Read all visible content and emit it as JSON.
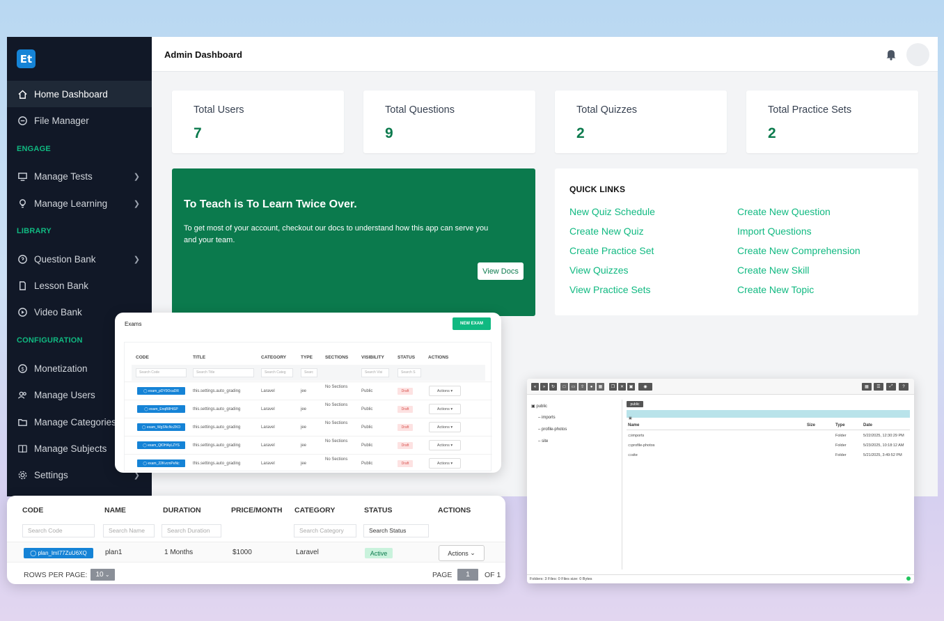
{
  "header": {
    "title": "Admin Dashboard"
  },
  "logo": {
    "text": "Et"
  },
  "sidebar": {
    "items": [
      {
        "label": "Home Dashboard",
        "icon": "home-icon"
      },
      {
        "label": "File Manager",
        "icon": "file-manager-icon"
      },
      {
        "label": "Manage Tests",
        "icon": "monitor-icon"
      },
      {
        "label": "Manage Learning",
        "icon": "bulb-icon"
      },
      {
        "label": "Question Bank",
        "icon": "question-icon"
      },
      {
        "label": "Lesson Bank",
        "icon": "document-icon"
      },
      {
        "label": "Video Bank",
        "icon": "play-icon"
      },
      {
        "label": "Monetization",
        "icon": "dollar-icon"
      },
      {
        "label": "Manage Users",
        "icon": "users-icon"
      },
      {
        "label": "Manage Categories",
        "icon": "folder-icon"
      },
      {
        "label": "Manage Subjects",
        "icon": "book-icon"
      },
      {
        "label": "Settings",
        "icon": "gear-icon"
      }
    ],
    "sections": [
      "ENGAGE",
      "LIBRARY",
      "CONFIGURATION"
    ]
  },
  "stats": [
    {
      "label": "Total Users",
      "value": "7"
    },
    {
      "label": "Total Questions",
      "value": "9"
    },
    {
      "label": "Total Quizzes",
      "value": "2"
    },
    {
      "label": "Total Practice Sets",
      "value": "2"
    }
  ],
  "hero": {
    "title": "To Teach is To Learn Twice Over.",
    "text": "To get most of your account, checkout our docs to understand how this app can serve you and your team.",
    "button": "View Docs"
  },
  "quick_links": {
    "title": "QUICK LINKS",
    "left": [
      "New Quiz Schedule",
      "Create New Quiz",
      "Create Practice Set",
      "View Quizzes",
      "View Practice Sets"
    ],
    "right": [
      "Create New Question",
      "Import Questions",
      "Create New Comprehension",
      "Create New Skill",
      "Create New Topic"
    ]
  },
  "exams": {
    "title": "Exams",
    "new_button": "NEW EXAM",
    "columns": [
      "CODE",
      "TITLE",
      "CATEGORY",
      "TYPE",
      "SECTIONS",
      "VISIBILITY",
      "STATUS",
      "ACTIONS"
    ],
    "search": [
      "Search Code",
      "Search Title",
      "Search Categ",
      "Searc",
      "Search Visi",
      "Search S"
    ],
    "rows": [
      {
        "code": "exam_pDY0OcaDR",
        "title": "this.settings.auto_grading",
        "category": "Laravel",
        "type": "jee",
        "sections": "No Sections",
        "visibility": "Public",
        "status": "Draft",
        "actions": "Actions"
      },
      {
        "code": "exam_EnqB8HiSP",
        "title": "this.settings.auto_grading",
        "category": "Laravel",
        "type": "jee",
        "sections": "No Sections",
        "visibility": "Public",
        "status": "Draft",
        "actions": "Actions"
      },
      {
        "code": "exam_WgSNcNcZKO",
        "title": "this.settings.auto_grading",
        "category": "Laravel",
        "type": "jee",
        "sections": "No Sections",
        "visibility": "Public",
        "status": "Draft",
        "actions": "Actions"
      },
      {
        "code": "exam_QlOHAyLZYS",
        "title": "this.settings.auto_grading",
        "category": "Laravel",
        "type": "jee",
        "sections": "No Sections",
        "visibility": "Public",
        "status": "Draft",
        "actions": "Actions"
      },
      {
        "code": "exam_22KvcmPeNc",
        "title": "this.settings.auto_grading",
        "category": "Laravel",
        "type": "jee",
        "sections": "No Sections",
        "visibility": "Public",
        "status": "Draft",
        "actions": "Actions"
      }
    ]
  },
  "file_manager": {
    "tree": [
      "public",
      "imports",
      "profile-photos",
      "site"
    ],
    "crumb": "public",
    "columns": [
      "Name",
      "Size",
      "Type",
      "Date"
    ],
    "rows": [
      {
        "name": "imports",
        "type": "Folder",
        "date": "5/22/2025, 12:30:29 PM"
      },
      {
        "name": "profile-photos",
        "type": "Folder",
        "date": "5/23/2025, 10:18:12 AM"
      },
      {
        "name": "site",
        "type": "Folder",
        "date": "5/21/2025, 3:49:52 PM"
      }
    ],
    "footer": "Folders: 3 Files: 0 Files size: 0 Bytes"
  },
  "plans": {
    "columns": [
      "CODE",
      "NAME",
      "DURATION",
      "PRICE/MONTH",
      "CATEGORY",
      "STATUS",
      "ACTIONS"
    ],
    "search": [
      "Search Code",
      "Search Name",
      "Search Duration",
      "Search Category",
      "Search Status"
    ],
    "row": {
      "code": "plan_lmI77ZuU6XQ",
      "name": "plan1",
      "duration": "1 Months",
      "price": "$1000",
      "category": "Laravel",
      "status": "Active",
      "actions": "Actions"
    },
    "rows_per_page_label": "ROWS PER PAGE:",
    "rows_per_page": "10",
    "page_label": "PAGE",
    "page": "1",
    "of_label": "OF 1"
  },
  "colors": {
    "accent": "#10b981",
    "brand_green": "#0b7a4d",
    "sidebar": "#111827",
    "code_badge": "#1583d6"
  }
}
